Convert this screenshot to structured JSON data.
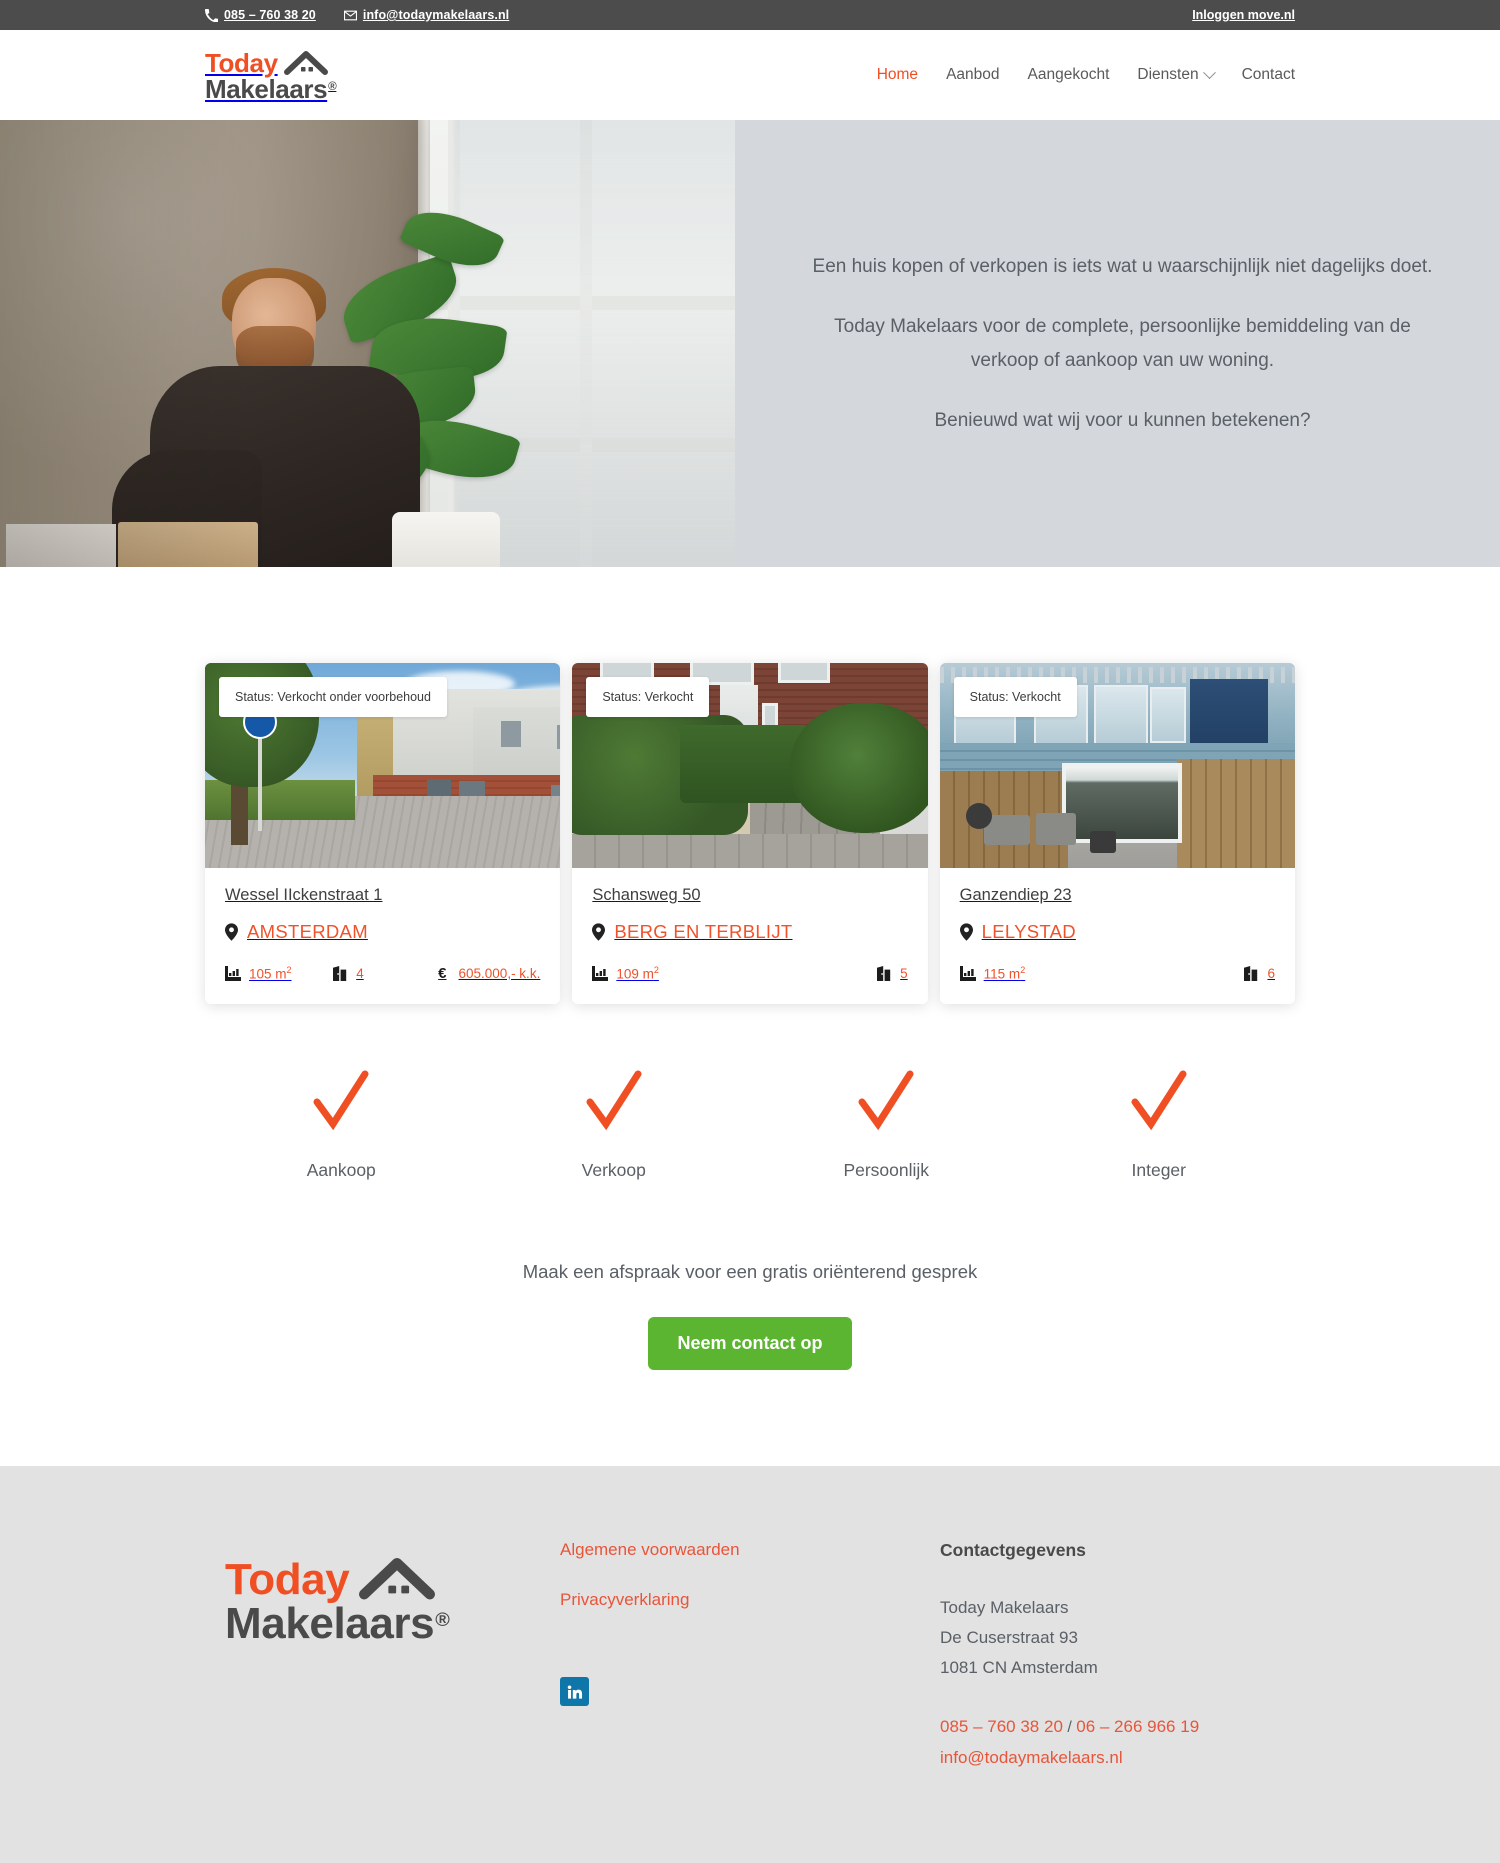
{
  "topbar": {
    "phone": "085 – 760 38 20",
    "email": "info@todaymakelaars.nl",
    "login": "Inloggen move.nl",
    "phone_icon": "phone-icon",
    "email_icon": "envelope-icon"
  },
  "header": {
    "logo": {
      "word1": "Today",
      "word2": "Makelaars",
      "registered": "®",
      "icon": "roof-icon"
    },
    "nav": [
      {
        "label": "Home",
        "active": true,
        "has_dropdown": false
      },
      {
        "label": "Aanbod",
        "active": false,
        "has_dropdown": false
      },
      {
        "label": "Aangekocht",
        "active": false,
        "has_dropdown": false
      },
      {
        "label": "Diensten",
        "active": false,
        "has_dropdown": true
      },
      {
        "label": "Contact",
        "active": false,
        "has_dropdown": false
      }
    ]
  },
  "hero": {
    "paragraphs": [
      "Een huis kopen of verkopen is iets wat u waarschijnlijk niet dagelijks doet.",
      "Today Makelaars voor de complete, persoonlijke bemiddeling van de verkoop of aankoop van uw woning.",
      "Benieuwd wat wij voor u kunnen betekenen?"
    ]
  },
  "listings": [
    {
      "status": "Status: Verkocht onder voorbehoud",
      "address": "Wessel IIckenstraat 1",
      "city": "AMSTERDAM",
      "size": "105 m",
      "size_unit": "2",
      "rooms": "4",
      "price": "605.000,- k.k.",
      "currency": "€",
      "has_price": true
    },
    {
      "status": "Status: Verkocht",
      "address": "Schansweg 50",
      "city": "BERG EN TERBLIJT",
      "size": "109 m",
      "size_unit": "2",
      "rooms": "5",
      "price": "",
      "currency": "€",
      "has_price": false
    },
    {
      "status": "Status: Verkocht",
      "address": "Ganzendiep 23",
      "city": "LELYSTAD",
      "size": "115 m",
      "size_unit": "2",
      "rooms": "6",
      "price": "",
      "currency": "€",
      "has_price": false
    }
  ],
  "usps": [
    {
      "label": "Aankoop",
      "icon": "check-icon"
    },
    {
      "label": "Verkoop",
      "icon": "check-icon"
    },
    {
      "label": "Persoonlijk",
      "icon": "check-icon"
    },
    {
      "label": "Integer",
      "icon": "check-icon"
    }
  ],
  "cta": {
    "text": "Maak een afspraak voor een gratis oriënterend gesprek",
    "button": "Neem contact op"
  },
  "footer": {
    "logo": {
      "word1": "Today",
      "word2": "Makelaars",
      "registered": "®",
      "icon": "roof-icon"
    },
    "links": [
      {
        "label": "Algemene voorwaarden"
      },
      {
        "label": "Privacyverklaring"
      }
    ],
    "social": {
      "name": "linkedin-icon",
      "label": "in"
    },
    "contact": {
      "heading": "Contactgegevens",
      "lines": [
        "Today Makelaars",
        "De Cuserstraat 93",
        "1081 CN Amsterdam"
      ],
      "phone1": "085 – 760 38 20",
      "separator": " / ",
      "phone2": "06 – 266 966 19",
      "email": "info@todaymakelaars.nl"
    }
  },
  "colors": {
    "brand_orange": "#f04e23",
    "link_orange": "#e8553a",
    "cta_green": "#5cb531",
    "topbar_gray": "#4c4c4c",
    "hero_panel": "#d4d8dd",
    "footer_gray": "#e2e2e2",
    "linkedin_blue": "#0e76a8"
  }
}
